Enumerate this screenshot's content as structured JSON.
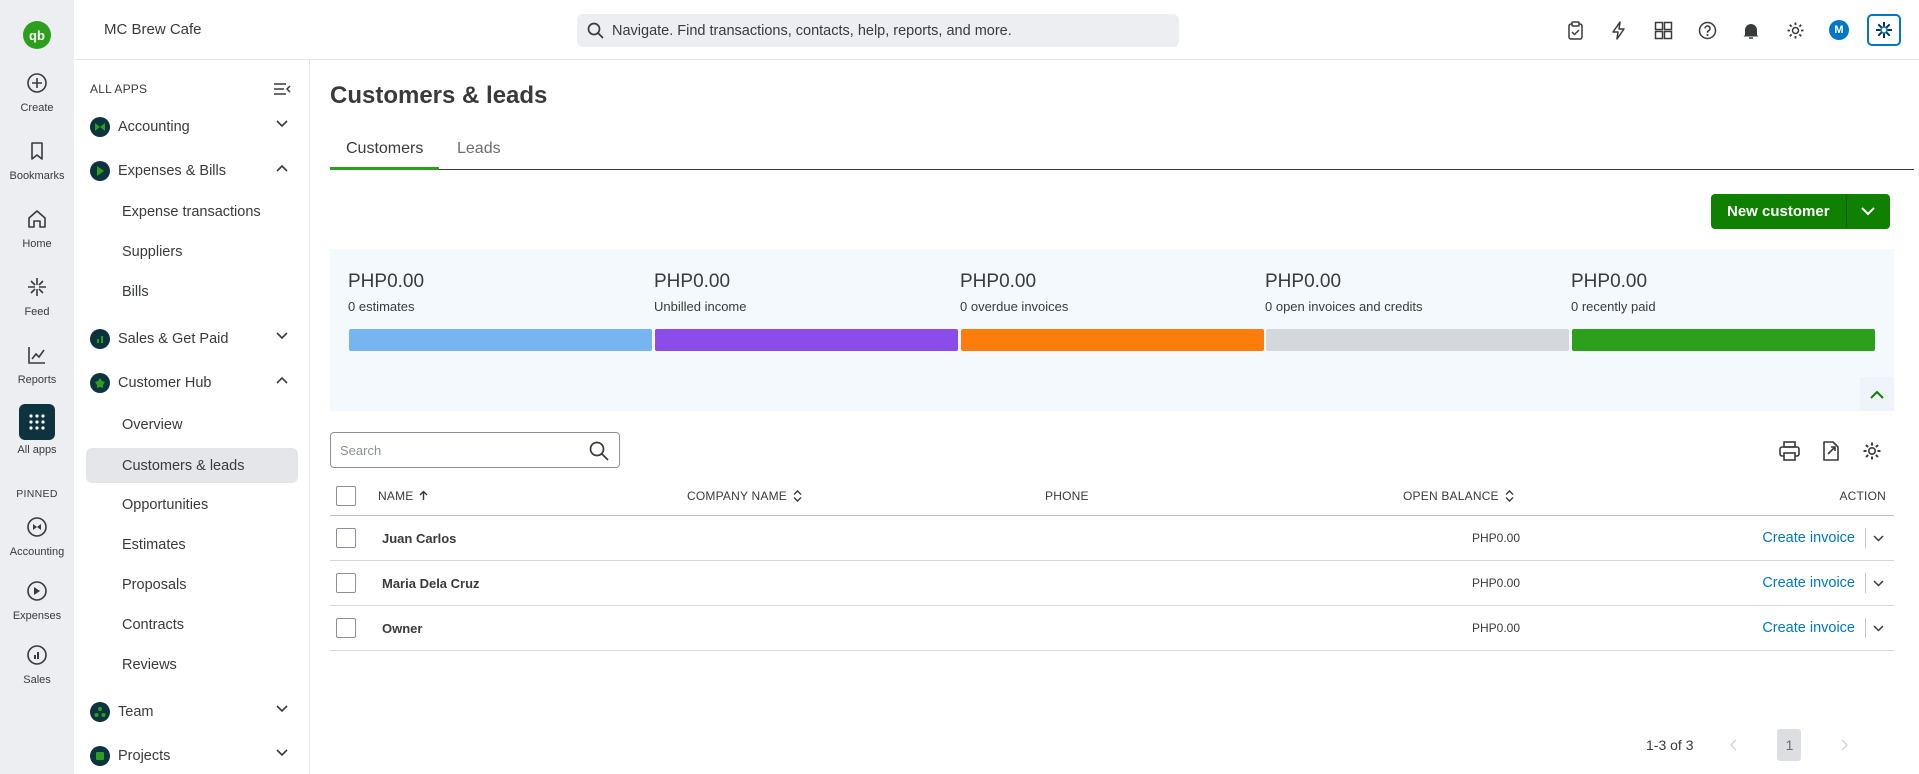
{
  "rail": {
    "logo": "qb",
    "items": [
      {
        "label": "Create",
        "icon": "plus-circle-icon"
      },
      {
        "label": "Bookmarks",
        "icon": "bookmark-icon"
      },
      {
        "label": "Home",
        "icon": "home-icon"
      },
      {
        "label": "Feed",
        "icon": "sparkle-icon"
      },
      {
        "label": "Reports",
        "icon": "chart-icon"
      },
      {
        "label": "All apps",
        "icon": "grid-icon"
      }
    ],
    "pinned_label": "PINNED",
    "pinned": [
      {
        "label": "Accounting",
        "icon": "accounting-icon"
      },
      {
        "label": "Expenses",
        "icon": "expenses-icon"
      },
      {
        "label": "Sales",
        "icon": "sales-icon"
      }
    ]
  },
  "topbar": {
    "company": "MC Brew Cafe",
    "search_placeholder": "Navigate. Find transactions, contacts, help, reports, and more.",
    "avatar": "M"
  },
  "sidebar": {
    "header": "ALL APPS",
    "groups": {
      "accounting": "Accounting",
      "expenses": "Expenses & Bills",
      "sales": "Sales & Get Paid",
      "customer_hub": "Customer Hub",
      "team": "Team",
      "projects": "Projects"
    },
    "expenses_items": [
      "Expense transactions",
      "Suppliers",
      "Bills"
    ],
    "customer_hub_items": [
      "Overview",
      "Customers & leads",
      "Opportunities",
      "Estimates",
      "Proposals",
      "Contracts",
      "Reviews"
    ]
  },
  "main": {
    "title": "Customers & leads",
    "tabs": [
      "Customers",
      "Leads"
    ],
    "new_customer_label": "New customer",
    "summary": [
      {
        "amount": "PHP0.00",
        "desc": "0 estimates",
        "color": "#77b5f2"
      },
      {
        "amount": "PHP0.00",
        "desc": "Unbilled income",
        "color": "#8c4ce9"
      },
      {
        "amount": "PHP0.00",
        "desc": "0 overdue invoices",
        "color": "#fc7d0c"
      },
      {
        "amount": "PHP0.00",
        "desc": "0 open invoices and credits",
        "color": "#d4d7dc"
      },
      {
        "amount": "PHP0.00",
        "desc": "0 recently paid",
        "color": "#2ca01c"
      }
    ],
    "search_placeholder": "Search",
    "columns": {
      "name": "NAME",
      "company": "COMPANY NAME",
      "phone": "PHONE",
      "balance": "OPEN BALANCE",
      "action": "ACTION"
    },
    "rows": [
      {
        "name": "Juan Carlos",
        "company": "",
        "phone": "",
        "balance": "PHP0.00",
        "action": "Create invoice"
      },
      {
        "name": "Maria Dela Cruz",
        "company": "",
        "phone": "",
        "balance": "PHP0.00",
        "action": "Create invoice"
      },
      {
        "name": "Owner",
        "company": "",
        "phone": "",
        "balance": "PHP0.00",
        "action": "Create invoice"
      }
    ],
    "pagination": {
      "range": "1-3 of 3",
      "page": "1"
    }
  }
}
